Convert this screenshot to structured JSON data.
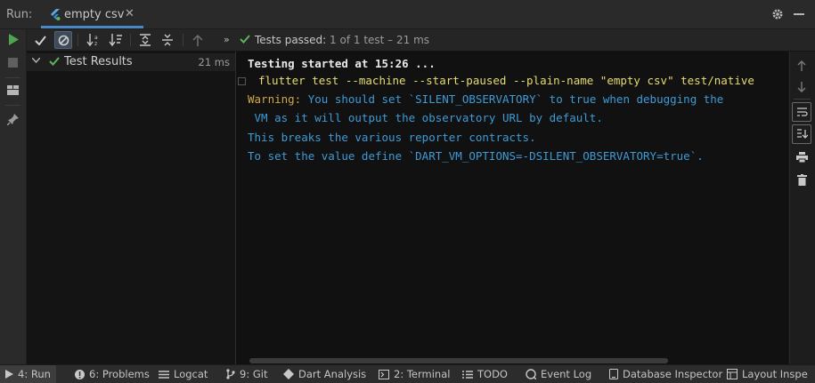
{
  "header": {
    "run_label": "Run:",
    "tab_label": "empty csv"
  },
  "toolbar": {
    "status_prefix": "Tests passed:",
    "status_detail": "1 of 1 test – 21 ms"
  },
  "tree": {
    "root_label": "Test Results",
    "root_time": "21 ms"
  },
  "console": {
    "line1": "Testing started at 15:26 ...",
    "line2": "flutter test --machine --start-paused --plain-name \"empty csv\" test/native",
    "line3_warn": "Warning:",
    "line3_rest": " You should set `SILENT_OBSERVATORY` to true when debugging the",
    "line4": " VM as it will output the observatory URL by default.",
    "line5": "This breaks the various reporter contracts.",
    "line6": "To set the value define `DART_VM_OPTIONS=-DSILENT_OBSERVATORY=true`."
  },
  "bottom_tabs": [
    {
      "label": "4: Run",
      "icon": "play-icon"
    },
    {
      "label": "6: Problems",
      "icon": "warning-icon"
    },
    {
      "label": "Logcat",
      "icon": "logcat-icon"
    },
    {
      "label": "9: Git",
      "icon": "git-icon"
    },
    {
      "label": "Dart Analysis",
      "icon": "dart-icon"
    },
    {
      "label": "2: Terminal",
      "icon": "terminal-icon"
    },
    {
      "label": "TODO",
      "icon": "list-icon"
    },
    {
      "label": "Event Log",
      "icon": "event-log-icon"
    },
    {
      "label": "Database Inspector",
      "icon": "database-icon"
    },
    {
      "label": "Layout Inspe",
      "icon": "layout-icon"
    }
  ],
  "colors": {
    "accent": "#4a88c7",
    "success": "#5fb35f",
    "console_yellow": "#e6db74",
    "console_blue": "#3f9ad6",
    "warning": "#d0a84c"
  }
}
